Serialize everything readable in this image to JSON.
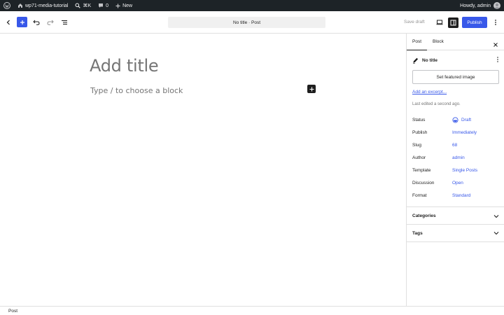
{
  "admin_bar": {
    "site_name": "wp71-media-tutorial",
    "shortcut": "⌘K",
    "comments_count": "0",
    "new_label": "New",
    "greeting": "Howdy, admin"
  },
  "header": {
    "document_title": "No title · Post",
    "save_draft_label": "Save draft",
    "publish_label": "Publish"
  },
  "canvas": {
    "title_placeholder": "Add title",
    "block_placeholder": "Type / to choose a block"
  },
  "sidebar": {
    "tabs": [
      {
        "label": "Post",
        "active": true
      },
      {
        "label": "Block",
        "active": false
      }
    ],
    "post_title": "No title",
    "featured_image_label": "Set featured image",
    "excerpt_link": "Add an excerpt...",
    "last_edited": "Last edited a second ago.",
    "meta": [
      {
        "label": "Status",
        "value": "Draft"
      },
      {
        "label": "Publish",
        "value": "Immediately"
      },
      {
        "label": "Slug",
        "value": "68"
      },
      {
        "label": "Author",
        "value": "admin"
      },
      {
        "label": "Template",
        "value": "Single Posts"
      },
      {
        "label": "Discussion",
        "value": "Open"
      },
      {
        "label": "Format",
        "value": "Standard"
      }
    ],
    "panels": [
      {
        "label": "Categories"
      },
      {
        "label": "Tags"
      }
    ]
  },
  "footer": {
    "breadcrumb": "Post"
  },
  "colors": {
    "accent": "#3858e9",
    "admin_bar_bg": "#1d2327",
    "text": "#1e1e1e",
    "muted": "#757575"
  },
  "icons": [
    "wordpress-logo-icon",
    "home-icon",
    "search-icon",
    "comment-icon",
    "plus-icon",
    "back-icon",
    "undo-icon",
    "redo-icon",
    "list-view-icon",
    "desktop-view-icon",
    "sidebar-icon",
    "more-vertical-icon",
    "close-icon",
    "post-icon",
    "draft-status-icon",
    "chevron-down-icon"
  ]
}
